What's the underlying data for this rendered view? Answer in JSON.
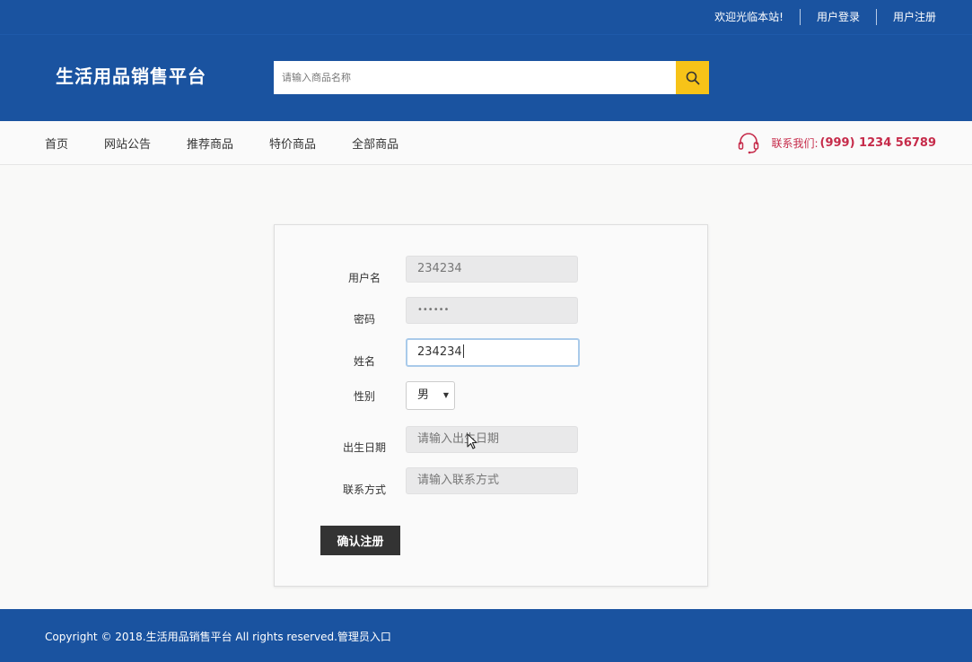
{
  "topbar": {
    "welcome": "欢迎光临本站!",
    "login": "用户登录",
    "register": "用户注册"
  },
  "header": {
    "logo": "生活用品销售平台",
    "search_placeholder": "请输入商品名称",
    "search_icon": "search-icon"
  },
  "nav": {
    "items": [
      "首页",
      "网站公告",
      "推荐商品",
      "特价商品",
      "全部商品"
    ],
    "contact_label": "联系我们:",
    "contact_phone": "(999) 1234 56789",
    "contact_icon": "headset-icon"
  },
  "form": {
    "username_label": "用户名",
    "username_value": "234234",
    "password_label": "密码",
    "password_value": "••••••",
    "name_label": "姓名",
    "name_value": "234234",
    "gender_label": "性别",
    "gender_value": "男",
    "birth_label": "出生日期",
    "birth_placeholder": "请输入出生日期",
    "contact_label": "联系方式",
    "contact_placeholder": "请输入联系方式",
    "submit_label": "确认注册"
  },
  "footer": {
    "copyright": "Copyright © 2018.生活用品销售平台 All rights reserved.管理员入口"
  },
  "colors": {
    "brand_blue": "#1a53a0",
    "search_button": "#f7c318",
    "contact_red": "#c62b4a",
    "submit_dark": "#333333"
  }
}
